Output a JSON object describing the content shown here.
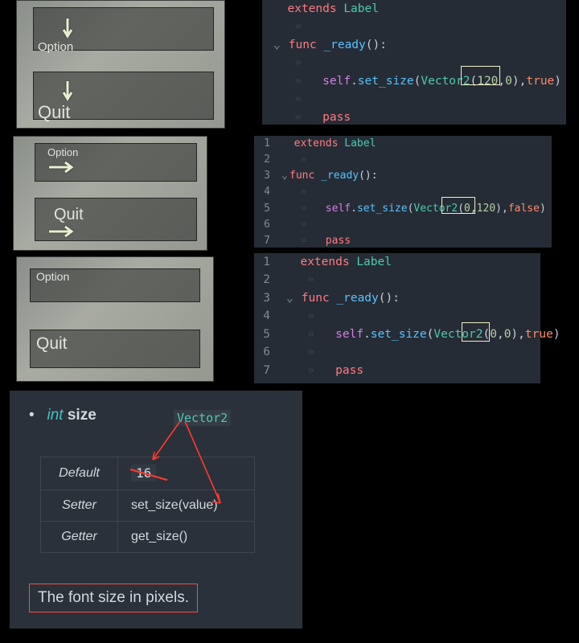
{
  "panels": {
    "g1": {
      "option": "Option",
      "quit": "Quit"
    },
    "g2": {
      "option": "Option",
      "quit": "Quit"
    },
    "g3": {
      "option": "Option",
      "quit": "Quit"
    }
  },
  "code": {
    "kw_extends": "extends",
    "kw_func": "func",
    "kw_pass": "pass",
    "kw_self": "self",
    "type_label": "Label",
    "type_vec": "Vector2",
    "fn_ready": "_ready",
    "fn_setsize": "set_size",
    "c1": {
      "arg1": "120",
      "arg2": "0",
      "bool": "true"
    },
    "c2": {
      "arg1": "0",
      "arg2": "120",
      "bool": "false"
    },
    "c3": {
      "arg1": "0",
      "arg2": "0",
      "bool": "true"
    }
  },
  "docs": {
    "type": "int",
    "name": "size",
    "chip": "Vector2",
    "default_k": "Default",
    "default_v": "16",
    "setter_k": "Setter",
    "setter_v": "set_size(value)",
    "getter_k": "Getter",
    "getter_v": "get_size()",
    "desc": "The font size in pixels."
  }
}
